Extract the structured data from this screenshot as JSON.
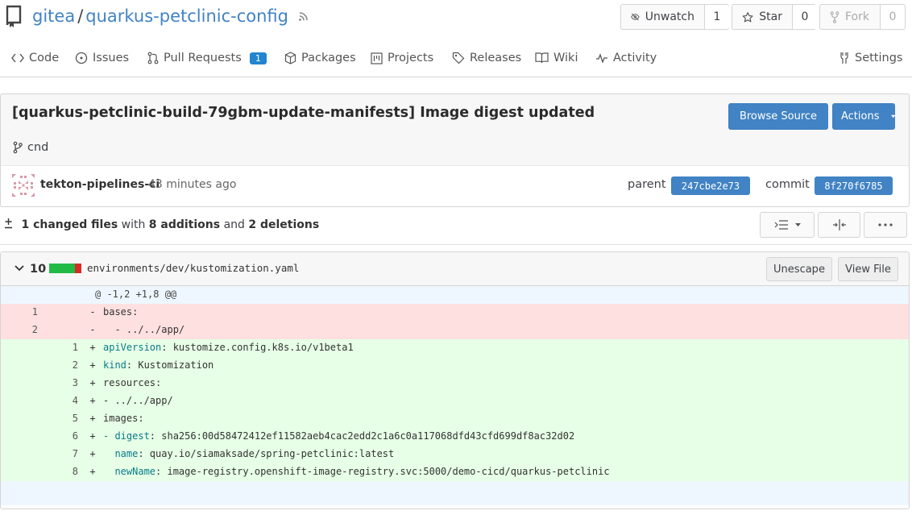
{
  "repo": {
    "owner": "gitea",
    "separator": "/",
    "name": "quarkus-petclinic-config"
  },
  "header_buttons": {
    "watch": {
      "label": "Unwatch",
      "count": "1"
    },
    "star": {
      "label": "Star",
      "count": "0"
    },
    "fork": {
      "label": "Fork",
      "count": "0"
    }
  },
  "tabs": {
    "code": "Code",
    "issues": "Issues",
    "pull_requests": "Pull Requests",
    "pull_requests_count": "1",
    "packages": "Packages",
    "projects": "Projects",
    "releases": "Releases",
    "wiki": "Wiki",
    "activity": "Activity",
    "settings": "Settings"
  },
  "commit": {
    "title": "[quarkus-petclinic-build-79gbm-update-manifests] Image digest updated",
    "branch": "cnd",
    "browse_source": "Browse Source",
    "actions": "Actions",
    "author": "tekton-pipelines-ci",
    "time": "43 minutes ago",
    "parent_label": "parent",
    "parent_sha": "247cbe2e73",
    "commit_label": "commit",
    "commit_sha": "8f270f6785"
  },
  "diff_stats": {
    "files": "1 changed files",
    "with": "with",
    "additions": "8 additions",
    "and": "and",
    "deletions": "2 deletions"
  },
  "file": {
    "changes": "10",
    "path": "environments/dev/kustomization.yaml",
    "unescape": "Unescape",
    "view_file": "View File",
    "hunk": "@ -1,2 +1,8 @@",
    "lines": [
      {
        "type": "del",
        "old": "1",
        "new": "",
        "sign": "-",
        "key": "",
        "text": "bases:"
      },
      {
        "type": "del",
        "old": "2",
        "new": "",
        "sign": "-",
        "key": "",
        "text": "  - ../../app/"
      },
      {
        "type": "add",
        "old": "",
        "new": "1",
        "sign": "+",
        "key": "apiVersion",
        "text": ": kustomize.config.k8s.io/v1beta1"
      },
      {
        "type": "add",
        "old": "",
        "new": "2",
        "sign": "+",
        "key": "kind",
        "text": ": Kustomization"
      },
      {
        "type": "add",
        "old": "",
        "new": "3",
        "sign": "+",
        "key": "",
        "text": "resources:"
      },
      {
        "type": "add",
        "old": "",
        "new": "4",
        "sign": "+",
        "key": "",
        "text": "- ../../app/"
      },
      {
        "type": "add",
        "old": "",
        "new": "5",
        "sign": "+",
        "key": "",
        "text": "images:"
      },
      {
        "type": "add",
        "old": "",
        "new": "6",
        "sign": "+",
        "key": "- digest",
        "text": ": sha256:00d58472412ef11582aeb4cac2edd2c1a6c0a117068dfd43cfd699df8ac32d02"
      },
      {
        "type": "add",
        "old": "",
        "new": "7",
        "sign": "+",
        "key": "  name",
        "text": ": quay.io/siamaksade/spring-petclinic:latest"
      },
      {
        "type": "add",
        "old": "",
        "new": "8",
        "sign": "+",
        "key": "  newName",
        "text": ": image-registry.openshift-image-registry.svc:5000/demo-cicd/quarkus-petclinic"
      }
    ]
  },
  "colors": {
    "link": "#4183c4",
    "primary": "#4183c4",
    "pr_badge": "#2185d0",
    "del_bg": "#ffe0e0",
    "add_bg": "#e6ffe6",
    "hunk_bg": "#eef7ff",
    "yaml_key": "#0a7a8a"
  }
}
